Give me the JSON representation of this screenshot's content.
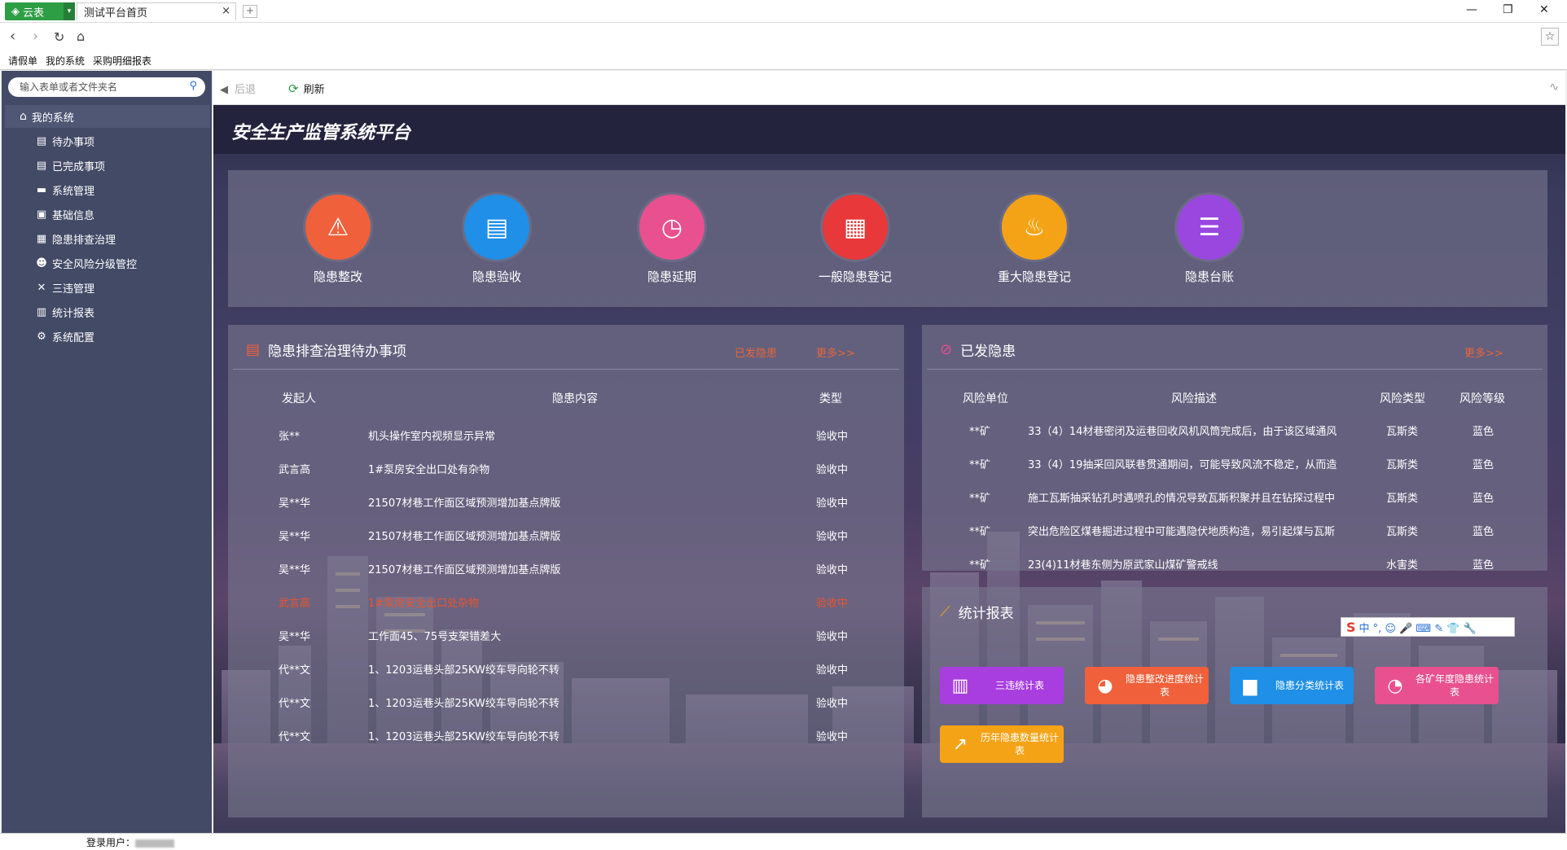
{
  "browser": {
    "app_tab": "云表",
    "page_tab": "测试平台首页",
    "address": "",
    "window_controls": [
      "—",
      "❐",
      "✕"
    ]
  },
  "favorites": [
    "请假单",
    "我的系统",
    "采购明细报表"
  ],
  "sidebar": {
    "search_placeholder": "输入表单或者文件夹名",
    "root": "我的系统",
    "items": [
      {
        "label": "待办事项",
        "icon": "list-icon"
      },
      {
        "label": "已完成事项",
        "icon": "list-icon"
      },
      {
        "label": "系统管理",
        "icon": "folder-icon"
      },
      {
        "label": "基础信息",
        "icon": "image-icon"
      },
      {
        "label": "隐患排查治理",
        "icon": "form-icon"
      },
      {
        "label": "安全风险分级管控",
        "icon": "users-icon"
      },
      {
        "label": "三违管理",
        "icon": "tools-icon"
      },
      {
        "label": "统计报表",
        "icon": "chart-icon"
      },
      {
        "label": "系统配置",
        "icon": "gear-icon"
      }
    ]
  },
  "content_toolbar": {
    "back": "后退",
    "refresh": "刷新"
  },
  "main": {
    "title": "安全生产监管系统平台",
    "quick_actions": [
      {
        "label": "隐患整改",
        "color": "#f0603a",
        "icon": "warning-icon",
        "glyph": "⚠"
      },
      {
        "label": "隐患验收",
        "color": "#1f8fe8",
        "icon": "book-icon",
        "glyph": "▤"
      },
      {
        "label": "隐患延期",
        "color": "#e8508f",
        "icon": "clock-icon",
        "glyph": "◷"
      },
      {
        "label": "一般隐患登记",
        "color": "#e8383a",
        "icon": "document-icon",
        "glyph": "▦"
      },
      {
        "label": "重大隐患登记",
        "color": "#f5a316",
        "icon": "alarm-icon",
        "glyph": "♨"
      },
      {
        "label": "隐患台账",
        "color": "#9a47e0",
        "icon": "stack-icon",
        "glyph": "☰"
      }
    ],
    "todo": {
      "title": "隐患排查治理待办事项",
      "link_issued": "已发隐患",
      "link_more": "更多>>",
      "headers": [
        "发起人",
        "隐患内容",
        "类型"
      ],
      "rows": [
        {
          "person": "张**",
          "content": "机头操作室内视频显示异常",
          "type": "验收中",
          "red": false
        },
        {
          "person": "武言高",
          "content": "1#泵房安全出口处有杂物",
          "type": "验收中",
          "red": false
        },
        {
          "person": "吴**华",
          "content": "21507材巷工作面区域预测增加基点牌版",
          "type": "验收中",
          "red": false
        },
        {
          "person": "吴**华",
          "content": "21507材巷工作面区域预测增加基点牌版",
          "type": "验收中",
          "red": false
        },
        {
          "person": "吴**华",
          "content": "21507材巷工作面区域预测增加基点牌版",
          "type": "验收中",
          "red": false
        },
        {
          "person": "武言高",
          "content": "1#泵房安全出口处杂物",
          "type": "验收中",
          "red": true
        },
        {
          "person": "吴**华",
          "content": "工作面45、75号支架错差大",
          "type": "验收中",
          "red": false
        },
        {
          "person": "代**文",
          "content": "1、1203运巷头部25KW绞车导向轮不转",
          "type": "验收中",
          "red": false
        },
        {
          "person": "代**文",
          "content": "1、1203运巷头部25KW绞车导向轮不转",
          "type": "验收中",
          "red": false
        },
        {
          "person": "代**文",
          "content": "1、1203运巷头部25KW绞车导向轮不转",
          "type": "验收中",
          "red": false
        }
      ]
    },
    "issued": {
      "title": "已发隐患",
      "link_more": "更多>>",
      "headers": [
        "风险单位",
        "风险描述",
        "风险类型",
        "风险等级"
      ],
      "rows": [
        {
          "unit": "**矿",
          "desc": "33（4）14材巷密闭及运巷回收风机风筒完成后，由于该区域通风",
          "type": "瓦斯类",
          "level": "蓝色"
        },
        {
          "unit": "**矿",
          "desc": "33（4）19抽采回风联巷贯通期间，可能导致风流不稳定，从而造",
          "type": "瓦斯类",
          "level": "蓝色"
        },
        {
          "unit": "**矿",
          "desc": "施工瓦斯抽采钻孔时遇喷孔的情况导致瓦斯积聚并且在钻探过程中",
          "type": "瓦斯类",
          "level": "蓝色"
        },
        {
          "unit": "**矿",
          "desc": "突出危险区煤巷掘进过程中可能遇隐伏地质构造，易引起煤与瓦斯",
          "type": "瓦斯类",
          "level": "蓝色"
        },
        {
          "unit": "**矿",
          "desc": "23(4)11材巷东侧为原武家山煤矿警戒线",
          "type": "水害类",
          "level": "蓝色"
        }
      ]
    },
    "stats": {
      "title": "统计报表",
      "buttons": [
        {
          "label": "三违统计表",
          "color": "#a83ee0",
          "icon": "bar-chart-icon",
          "glyph": "▥"
        },
        {
          "label": "隐患整改进度统计表",
          "color": "#f0603a",
          "icon": "pie-chart-icon",
          "glyph": "◕"
        },
        {
          "label": "隐患分类统计表",
          "color": "#1f8fe8",
          "icon": "column-chart-icon",
          "glyph": "▆"
        },
        {
          "label": "各矿年度隐患统计表",
          "color": "#e8508f",
          "icon": "donut-chart-icon",
          "glyph": "◔"
        },
        {
          "label": "历年隐患数量统计表",
          "color": "#f5a316",
          "icon": "trend-chart-icon",
          "glyph": "↗"
        }
      ]
    }
  },
  "ime": {
    "logo": "S",
    "text": "中 °, ☺ 🎤 ⌨ ✎ 👕 🔧"
  },
  "status": {
    "user_label": "登录用户："
  }
}
